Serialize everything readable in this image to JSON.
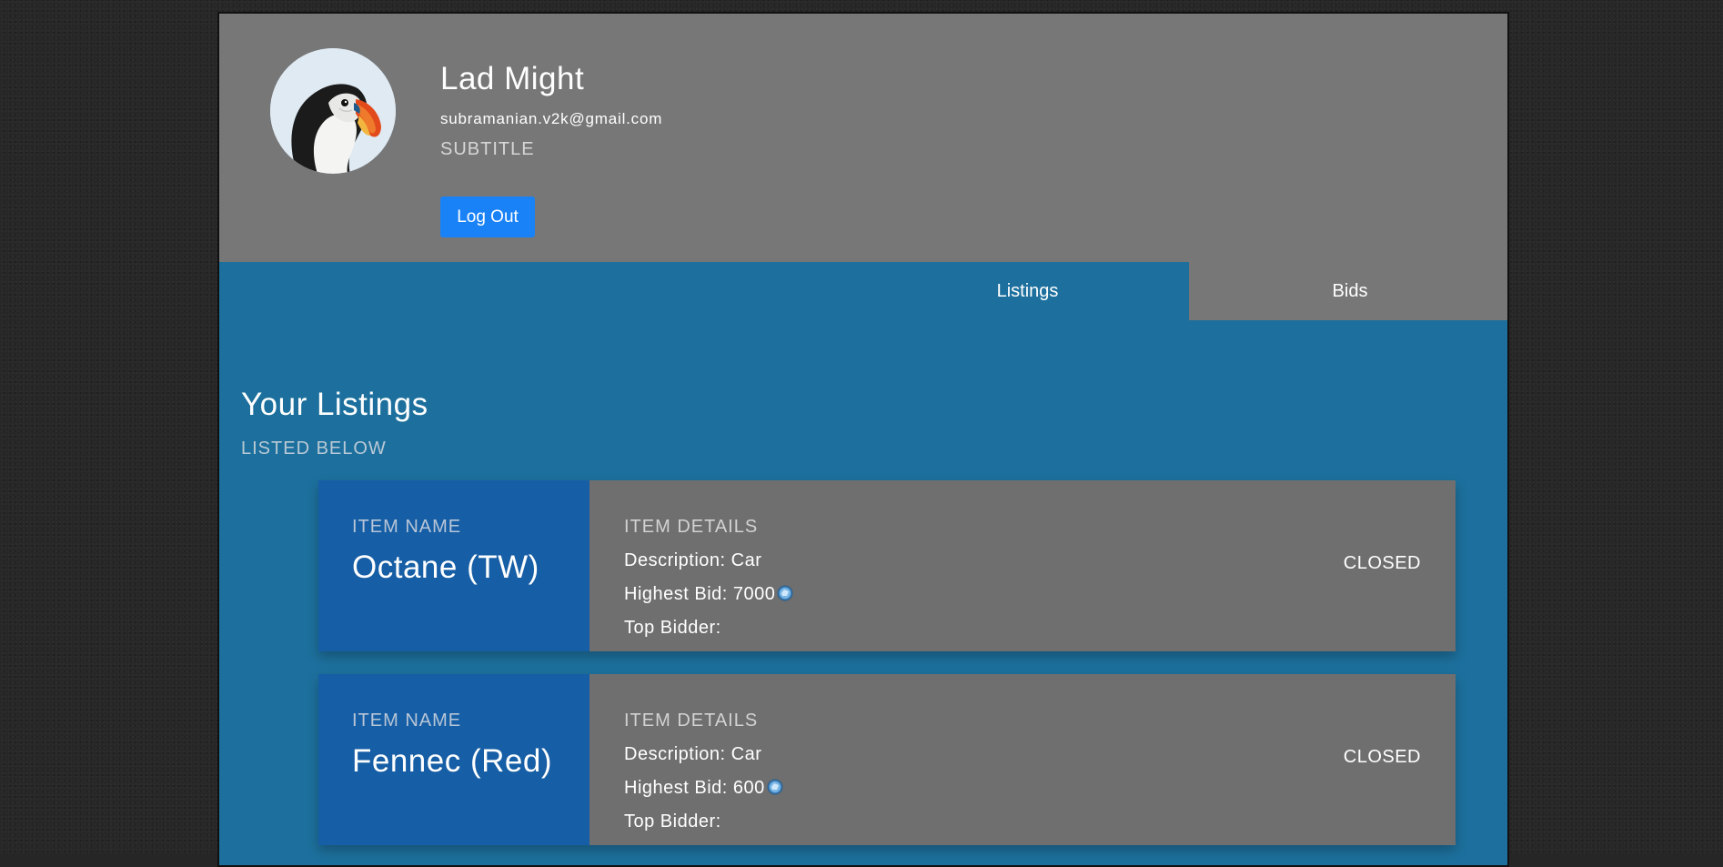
{
  "profile": {
    "name": "Lad Might",
    "email": "subramanian.v2k@gmail.com",
    "subtitle": "SUBTITLE",
    "logout_label": "Log Out",
    "avatar_icon": "puffin-avatar-image"
  },
  "tabs": [
    {
      "label": "Listings",
      "active": true
    },
    {
      "label": "Bids",
      "active": false
    }
  ],
  "listings_section": {
    "title": "Your Listings",
    "subtitle": "LISTED BELOW"
  },
  "listings": [
    {
      "name_label": "ITEM NAME",
      "name": "Octane (TW)",
      "details_label": "ITEM DETAILS",
      "description": "Description: Car",
      "highest_bid": "Highest Bid: 7000",
      "top_bidder": "Top Bidder:",
      "status": "CLOSED",
      "currency_icon": "credits-coin-icon"
    },
    {
      "name_label": "ITEM NAME",
      "name": "Fennec (Red)",
      "details_label": "ITEM DETAILS",
      "description": "Description: Car",
      "highest_bid": "Highest Bid: 600",
      "top_bidder": "Top Bidder:",
      "status": "CLOSED",
      "currency_icon": "credits-coin-icon"
    }
  ],
  "colors": {
    "header_bg": "#777777",
    "main_bg": "#1d709d",
    "card_name_bg": "#165ea5",
    "card_details_bg": "#6f6f6f",
    "button_bg": "#1a82f7"
  }
}
